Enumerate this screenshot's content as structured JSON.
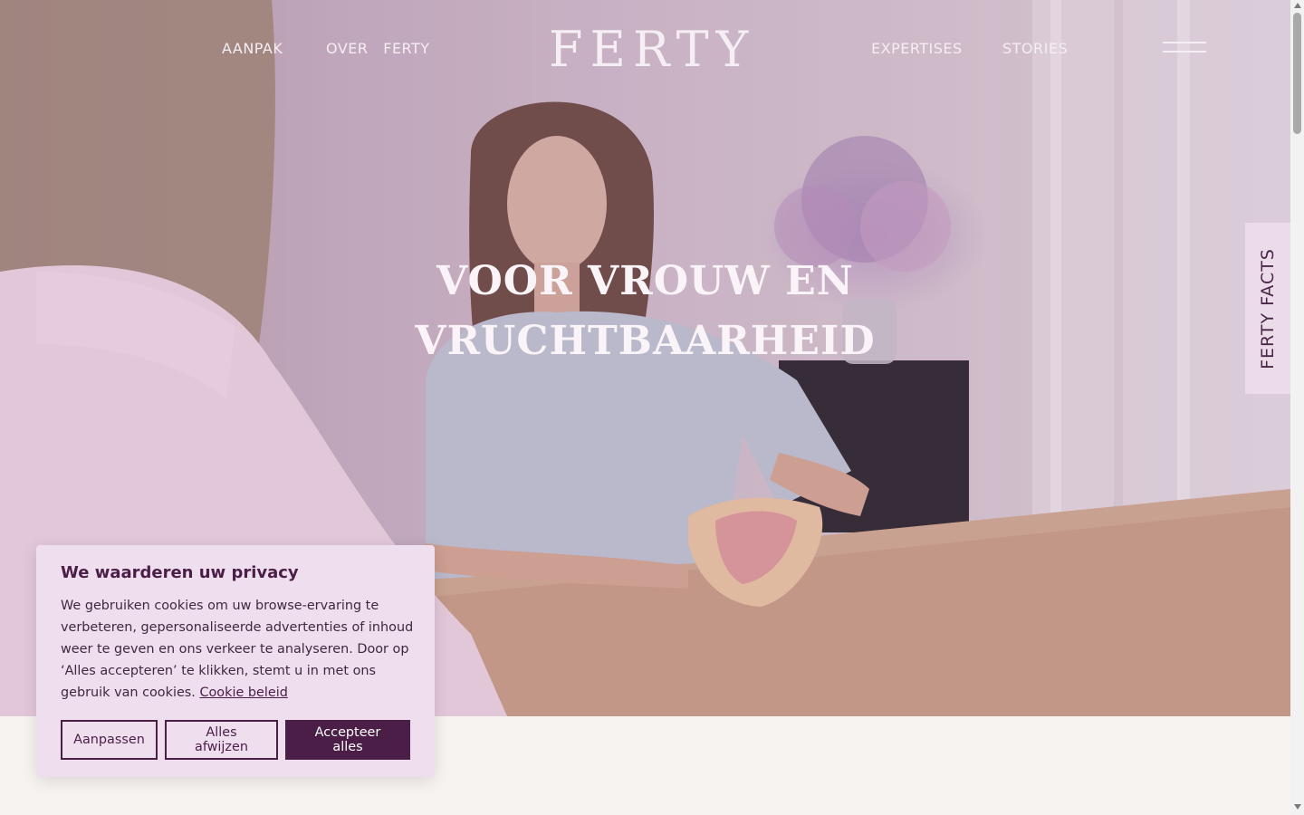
{
  "nav": {
    "left": [
      {
        "label": "AANPAK"
      },
      {
        "label": "OVER   FERTY"
      }
    ],
    "right": [
      {
        "label": "EXPERTISES"
      },
      {
        "label": "STORIES"
      }
    ],
    "logo": "FERTY"
  },
  "hero": {
    "headline_line1": "VOOR VROUW EN",
    "headline_line2": "VRUCHTBAARHEID"
  },
  "side_tab": {
    "label": "FERTY FACTS"
  },
  "cookie": {
    "title": "We waarderen uw privacy",
    "text": "We gebruiken cookies om uw browse-ervaring te verbeteren, gepersonaliseerde advertenties of inhoud weer te geven en ons verkeer te analyseren. Door op ‘Alles accepteren’ te klikken, stemt u in met ons gebruik van cookies.",
    "link": "Cookie beleid",
    "buttons": {
      "customize": "Aanpassen",
      "reject": "Alles afwijzen",
      "accept": "Accepteer alles"
    }
  },
  "colors": {
    "accent": "#4a1e47",
    "panel": "#efdeee",
    "tab": "#ecdcea",
    "page_bg": "#f7f3f1"
  },
  "icons": {
    "menu": "hamburger-icon"
  }
}
